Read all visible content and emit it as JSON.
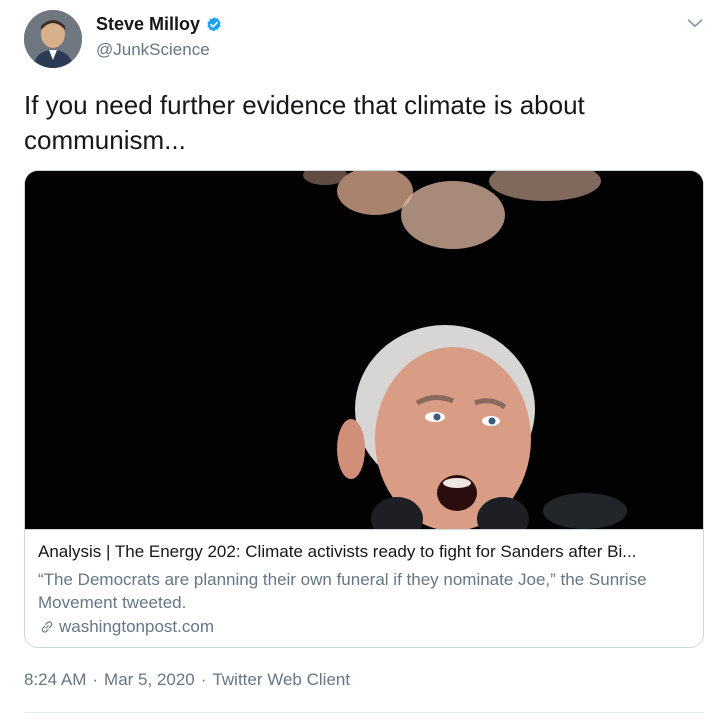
{
  "user": {
    "display_name": "Steve Milloy",
    "handle": "@JunkScience",
    "verified": true
  },
  "tweet": {
    "text": "If you need further evidence that climate is about communism...",
    "time": "8:24 AM",
    "date": "Mar 5, 2020",
    "separator": "·",
    "client": "Twitter Web Client"
  },
  "card": {
    "title": "Analysis | The Energy 202: Climate activists ready to fight for Sanders after Bi...",
    "description": "“The Democrats are planning their own funeral if they nominate Joe,” the Sunrise Movement tweeted.",
    "domain": "washingtonpost.com"
  },
  "icons": {
    "verified": "verified-badge-icon",
    "chevron": "chevron-down-icon",
    "link": "link-icon"
  },
  "colors": {
    "primary_text": "#14171a",
    "secondary_text": "#657786",
    "verified_blue": "#1da1f2",
    "border": "#ccd6dd"
  }
}
